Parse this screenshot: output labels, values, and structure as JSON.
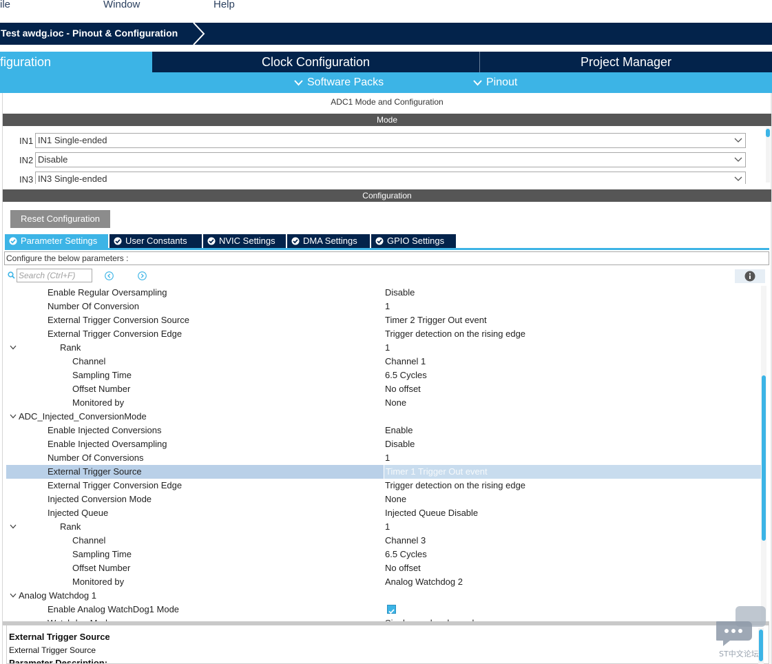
{
  "menu": {
    "file": "ile",
    "window": "Window",
    "help": "Help"
  },
  "breadcrumb": {
    "title": "Test awdg.ioc - Pinout & Configuration"
  },
  "main_tabs": [
    {
      "label": "figuration",
      "active": true
    },
    {
      "label": "Clock Configuration",
      "active": false
    },
    {
      "label": "Project Manager",
      "active": false
    }
  ],
  "sub_menu": {
    "software_packs": "Software Packs",
    "pinout": "Pinout"
  },
  "panel": {
    "title": "ADC1 Mode and Configuration",
    "mode_header": "Mode",
    "configuration_header": "Configuration"
  },
  "mode_rows": [
    {
      "label": "IN1",
      "value": "IN1 Single-ended"
    },
    {
      "label": "IN2",
      "value": "Disable"
    },
    {
      "label": "IN3",
      "value": "IN3 Single-ended"
    }
  ],
  "config": {
    "reset_button": "Reset Configuration",
    "tabs": [
      {
        "label": "Parameter Settings",
        "active": true
      },
      {
        "label": "User Constants",
        "active": false
      },
      {
        "label": "NVIC Settings",
        "active": false
      },
      {
        "label": "DMA Settings",
        "active": false
      },
      {
        "label": "GPIO Settings",
        "active": false
      }
    ],
    "instruction": "Configure the below parameters :",
    "search_placeholder": "Search (Ctrl+F)"
  },
  "params": [
    {
      "name": "Enable Regular Oversampling",
      "value": "Disable",
      "level": 2
    },
    {
      "name": "Number Of Conversion",
      "value": "1",
      "level": 2
    },
    {
      "name": "External Trigger Conversion Source",
      "value": "Timer 2 Trigger Out event",
      "level": 2
    },
    {
      "name": "External Trigger Conversion Edge",
      "value": "Trigger detection on the rising edge",
      "level": 2
    },
    {
      "name": "Rank",
      "value": "1",
      "level": 3,
      "expanded": true
    },
    {
      "name": "Channel",
      "value": "Channel 1",
      "level": 4
    },
    {
      "name": "Sampling Time",
      "value": "6.5 Cycles",
      "level": 4
    },
    {
      "name": "Offset Number",
      "value": "No offset",
      "level": 4
    },
    {
      "name": "Monitored by",
      "value": "None",
      "level": 4
    },
    {
      "name": "ADC_Injected_ConversionMode",
      "value": "",
      "level": 1,
      "expanded": true
    },
    {
      "name": "Enable Injected Conversions",
      "value": "Enable",
      "level": 2
    },
    {
      "name": "Enable Injected Oversampling",
      "value": "Disable",
      "level": 2
    },
    {
      "name": "Number Of Conversions",
      "value": "1",
      "level": 2
    },
    {
      "name": "External Trigger Source",
      "value": "Timer 1 Trigger Out event",
      "level": 2,
      "selected": true
    },
    {
      "name": "External Trigger Conversion Edge",
      "value": "Trigger detection on the rising edge",
      "level": 2
    },
    {
      "name": "Injected Conversion Mode",
      "value": "None",
      "level": 2
    },
    {
      "name": "Injected Queue",
      "value": "Injected Queue Disable",
      "level": 2
    },
    {
      "name": "Rank",
      "value": "1",
      "level": 3,
      "expanded": true
    },
    {
      "name": "Channel",
      "value": "Channel 3",
      "level": 4
    },
    {
      "name": "Sampling Time",
      "value": "6.5 Cycles",
      "level": 4
    },
    {
      "name": "Offset Number",
      "value": "No offset",
      "level": 4
    },
    {
      "name": "Monitored by",
      "value": "Analog Watchdog 2",
      "level": 4
    },
    {
      "name": "Analog Watchdog 1",
      "value": "",
      "level": 1,
      "expanded": true
    },
    {
      "name": "Enable Analog WatchDog1 Mode",
      "value": "",
      "level": 2,
      "checkbox": true,
      "checked": true
    },
    {
      "name": "Watchdog Mode",
      "value": "Single regular channel",
      "level": 2
    }
  ],
  "description": {
    "heading": "External Trigger Source",
    "subtitle": "External Trigger Source",
    "param_label": "Parameter Description:"
  },
  "watermark": "ST中文论坛",
  "colors": {
    "navy": "#03234b",
    "accent": "#3cb4e6",
    "selection": "#b9d0e8",
    "section_bar": "#565656"
  }
}
